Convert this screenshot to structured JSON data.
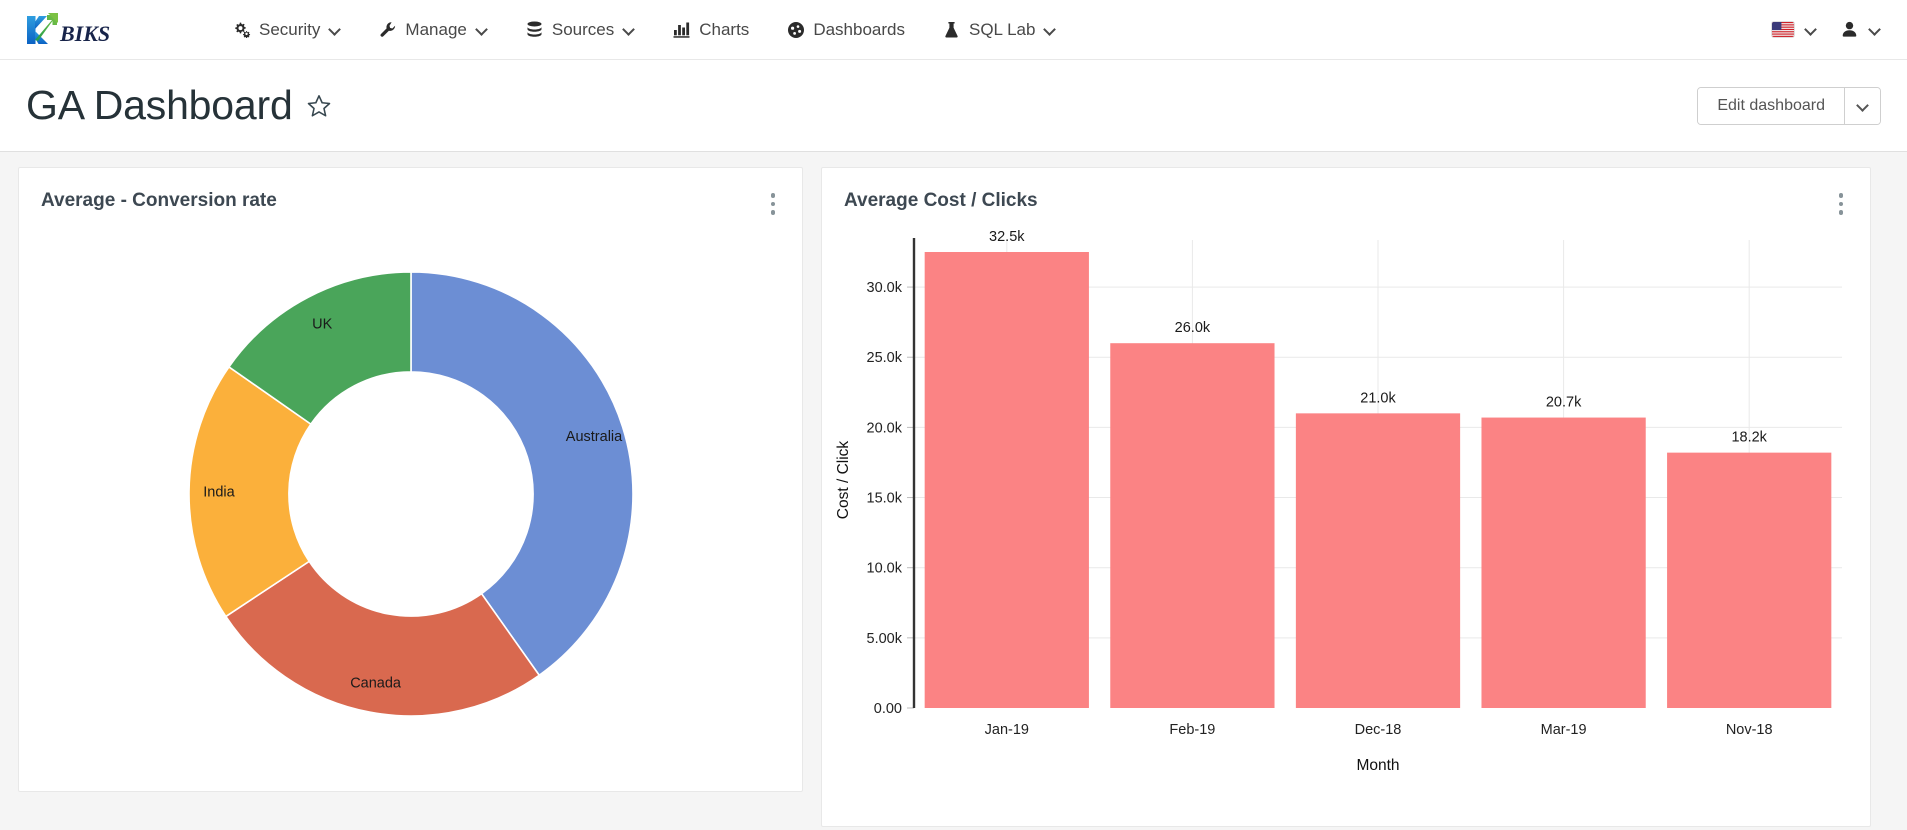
{
  "brand": {
    "logo_letter": "K",
    "logo_text": "BIKS",
    "logo_blue": "#1a7fd4",
    "logo_green": "#34a853",
    "logo_text_color": "#1a2b4a"
  },
  "nav": {
    "items": [
      {
        "label": "Security",
        "icon": "cogs-icon",
        "has_caret": true
      },
      {
        "label": "Manage",
        "icon": "wrench-icon",
        "has_caret": true
      },
      {
        "label": "Sources",
        "icon": "database-icon",
        "has_caret": true
      },
      {
        "label": "Charts",
        "icon": "bar-chart-icon",
        "has_caret": false
      },
      {
        "label": "Dashboards",
        "icon": "dashboard-icon",
        "has_caret": false
      },
      {
        "label": "SQL Lab",
        "icon": "flask-icon",
        "has_caret": true
      }
    ],
    "right": {
      "language_icon": "us-flag-icon",
      "user_icon": "user-icon"
    }
  },
  "page": {
    "title": "GA Dashboard",
    "favorite_icon": "star-outline-icon",
    "edit_button": "Edit dashboard",
    "edit_button_caret_icon": "chevron-down-icon"
  },
  "cards": [
    {
      "title": "Average - Conversion rate",
      "menu_icon": "kebab-menu-icon"
    },
    {
      "title": "Average Cost / Clicks",
      "menu_icon": "kebab-menu-icon"
    }
  ],
  "chart_data": [
    {
      "type": "pie",
      "variant": "donut",
      "title": "Average - Conversion rate",
      "labels": [
        "Australia",
        "Canada",
        "India",
        "UK"
      ],
      "values": [
        40.2,
        25.5,
        19.0,
        15.3
      ],
      "colors": [
        "#6c8ed4",
        "#d9694f",
        "#fbb03b",
        "#4aa55a"
      ],
      "start_angle_deg": 0,
      "inner_radius_ratio": 0.55,
      "legend": "none",
      "labels_inside": true
    },
    {
      "type": "bar",
      "title": "Average Cost / Clicks",
      "categories": [
        "Jan-19",
        "Feb-19",
        "Dec-18",
        "Mar-19",
        "Nov-18"
      ],
      "values": [
        32500,
        26000,
        21000,
        20700,
        18200
      ],
      "value_labels": [
        "32.5k",
        "26.0k",
        "21.0k",
        "20.7k",
        "18.2k"
      ],
      "xlabel": "Month",
      "ylabel": "Cost / Click",
      "ylim": [
        0,
        32500
      ],
      "ytick_labels": [
        "0.00",
        "5.00k",
        "10.0k",
        "15.0k",
        "20.0k",
        "25.0k",
        "30.0k"
      ],
      "ytick_values": [
        0,
        5000,
        10000,
        15000,
        20000,
        25000,
        30000
      ],
      "bar_color": "#fb8384",
      "grid": true,
      "legend": "none"
    }
  ]
}
